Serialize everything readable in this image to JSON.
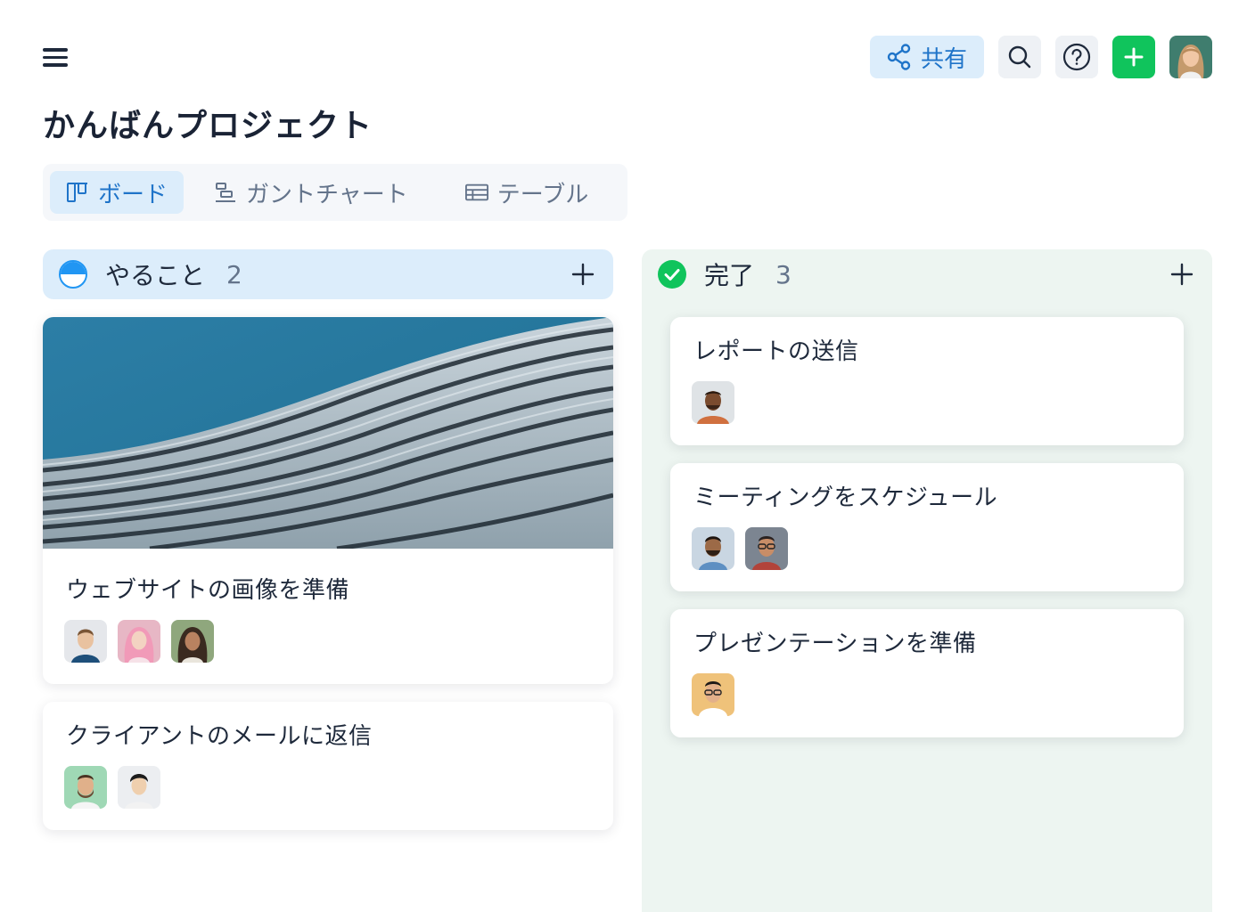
{
  "header": {
    "share_label": "共有",
    "title": "かんばんプロジェクト"
  },
  "icons": {
    "menu": "hamburger-icon",
    "share": "share-icon",
    "search": "search-icon",
    "help": "help-icon",
    "add": "plus-icon"
  },
  "tabs": [
    {
      "label": "ボード",
      "icon": "board-icon",
      "active": true
    },
    {
      "label": "ガントチャート",
      "icon": "gantt-icon",
      "active": false
    },
    {
      "label": "テーブル",
      "icon": "table-icon",
      "active": false
    }
  ],
  "columns": [
    {
      "title": "やること",
      "count": "2",
      "cards": [
        {
          "title": "ウェブサイトの画像を準備",
          "has_cover": true,
          "assignees": 3
        },
        {
          "title": "クライアントのメールに返信",
          "assignees": 2
        }
      ]
    },
    {
      "title": "完了",
      "count": "3",
      "cards": [
        {
          "title": "レポートの送信",
          "assignees": 1
        },
        {
          "title": "ミーティングをスケジュール",
          "assignees": 2
        },
        {
          "title": "プレゼンテーションを準備",
          "assignees": 1
        }
      ]
    }
  ],
  "colors": {
    "accent": "#1f74c9",
    "accent_bg": "#dcedfb",
    "success": "#10c45c",
    "done_column_bg": "#edf5f1"
  }
}
